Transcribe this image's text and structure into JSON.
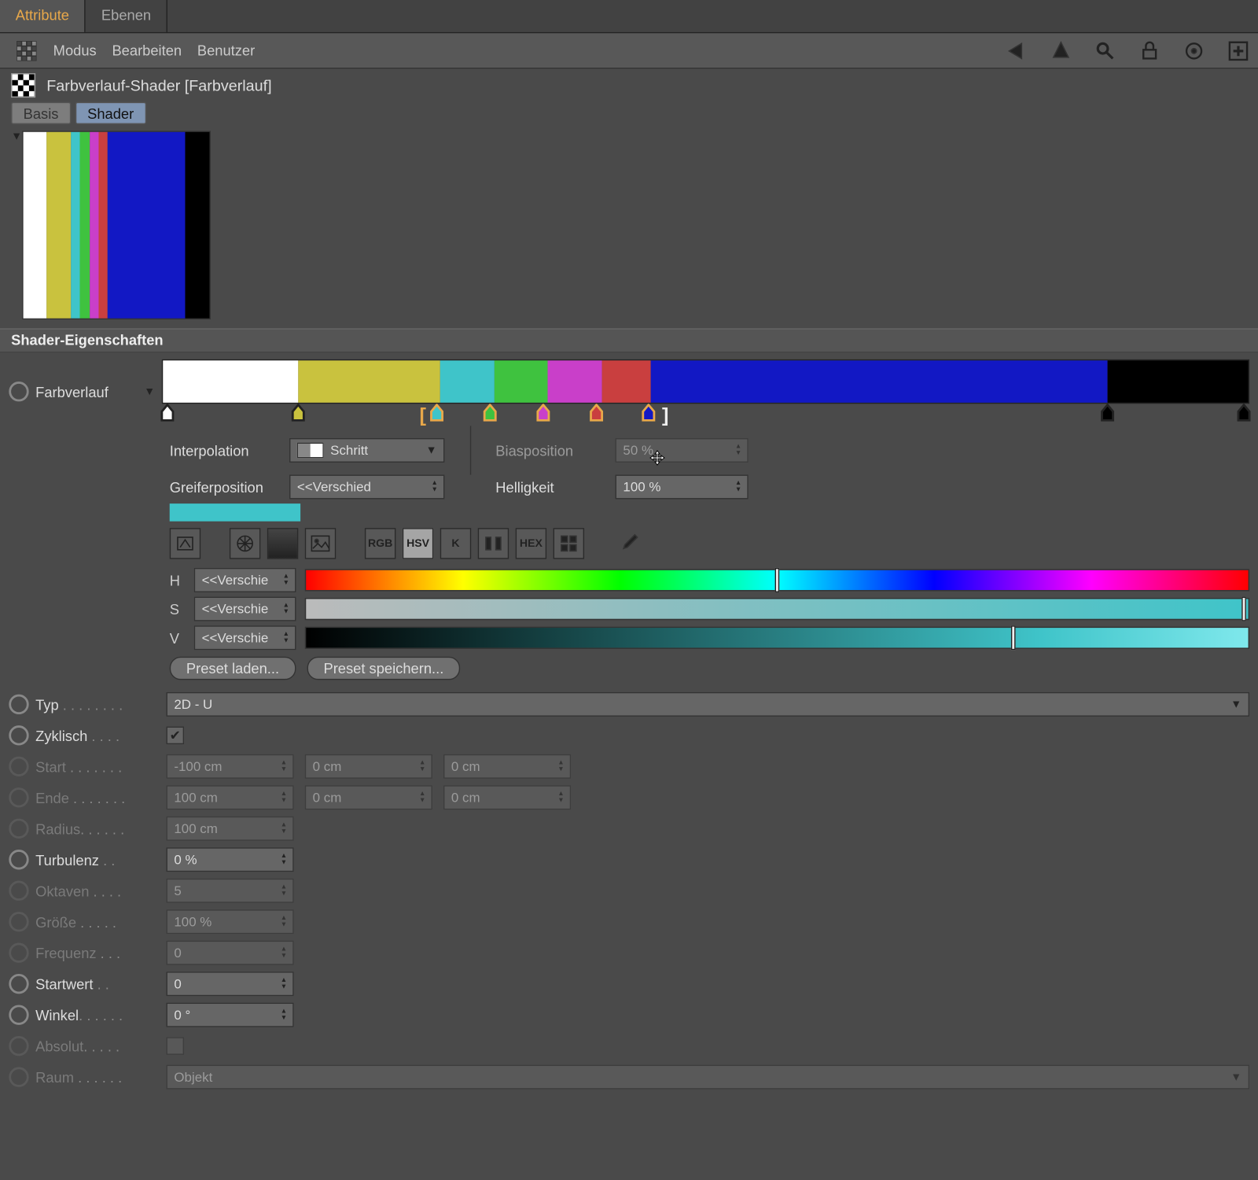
{
  "top_tabs": {
    "attribute": "Attribute",
    "ebenen": "Ebenen"
  },
  "toolbar": {
    "modus": "Modus",
    "bearbeiten": "Bearbeiten",
    "benutzer": "Benutzer"
  },
  "title": "Farbverlauf-Shader [Farbverlauf]",
  "sub_tabs": {
    "basis": "Basis",
    "shader": "Shader"
  },
  "section": "Shader-Eigenschaften",
  "gradient": {
    "label": "Farbverlauf",
    "segments": [
      {
        "color": "#ffffff",
        "w": 12.5
      },
      {
        "color": "#c9c23e",
        "w": 13.0
      },
      {
        "color": "#3fc4c9",
        "w": 5.0
      },
      {
        "color": "#3fc23f",
        "w": 5.0
      },
      {
        "color": "#c93fc9",
        "w": 5.0
      },
      {
        "color": "#c93f3f",
        "w": 4.5
      },
      {
        "color": "#1218c4",
        "w": 42.0
      },
      {
        "color": "#000000",
        "w": 13.0
      }
    ],
    "knots": [
      {
        "pos": 0.5,
        "color": "#ffffff",
        "sel": false
      },
      {
        "pos": 12.5,
        "color": "#c9c23e",
        "sel": false
      },
      {
        "pos": 25.3,
        "color": "#3fc4c9",
        "sel": true
      },
      {
        "pos": 30.2,
        "color": "#3fc23f",
        "sel": true
      },
      {
        "pos": 35.1,
        "color": "#c93fc9",
        "sel": true
      },
      {
        "pos": 40.0,
        "color": "#c93f3f",
        "sel": true
      },
      {
        "pos": 44.8,
        "color": "#1218c4",
        "sel": true
      },
      {
        "pos": 87.0,
        "color": "#000000",
        "sel": false
      },
      {
        "pos": 99.5,
        "color": "#000000",
        "sel": false
      }
    ],
    "bracket_left_pos": 24.0,
    "bracket_right_pos": 46.3
  },
  "interp": {
    "label": "Interpolation",
    "value": "Schritt"
  },
  "greifer": {
    "label": "Greiferposition",
    "value": "<<Verschied"
  },
  "bias": {
    "label": "Biasposition",
    "value": "50 %"
  },
  "hell": {
    "label": "Helligkeit",
    "value": "100 %"
  },
  "swatch_color": "#3fc4c9",
  "modes": {
    "rgb": "RGB",
    "hsv": "HSV",
    "k": "K",
    "hex": "HEX"
  },
  "hsv": {
    "h": {
      "label": "H",
      "value": "<<Verschie",
      "mark": 50
    },
    "s": {
      "label": "S",
      "value": "<<Verschie",
      "mark": 100
    },
    "v": {
      "label": "V",
      "value": "<<Verschie",
      "mark": 75
    }
  },
  "presets": {
    "load": "Preset laden...",
    "save": "Preset speichern..."
  },
  "typ": {
    "label": "Typ",
    "value": "2D - U"
  },
  "zyklisch": {
    "label": "Zyklisch",
    "checked": true
  },
  "start": {
    "label": "Start",
    "x": "-100 cm",
    "y": "0 cm",
    "z": "0 cm"
  },
  "ende": {
    "label": "Ende",
    "x": "100 cm",
    "y": "0 cm",
    "z": "0 cm"
  },
  "radius": {
    "label": "Radius",
    "value": "100 cm"
  },
  "turbulenz": {
    "label": "Turbulenz",
    "value": "0 %"
  },
  "oktaven": {
    "label": "Oktaven",
    "value": "5"
  },
  "groesse": {
    "label": "Größe",
    "value": "100 %"
  },
  "frequenz": {
    "label": "Frequenz",
    "value": "0"
  },
  "startwert": {
    "label": "Startwert",
    "value": "0"
  },
  "winkel": {
    "label": "Winkel",
    "value": "0 °"
  },
  "absolut": {
    "label": "Absolut"
  },
  "raum": {
    "label": "Raum",
    "value": "Objekt"
  }
}
